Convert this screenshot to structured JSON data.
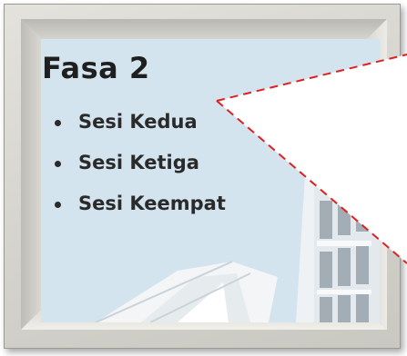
{
  "slide": {
    "heading": "Fasa 2",
    "items": [
      {
        "label": "Sesi Kedua"
      },
      {
        "label": "Sesi Ketiga"
      },
      {
        "label": "Sesi Keempat"
      }
    ]
  },
  "colors": {
    "frame": "#d3d2cc",
    "photo_sky": "#d6e6f0",
    "callout_line": "#e02020",
    "text": "#1f1f1f"
  }
}
